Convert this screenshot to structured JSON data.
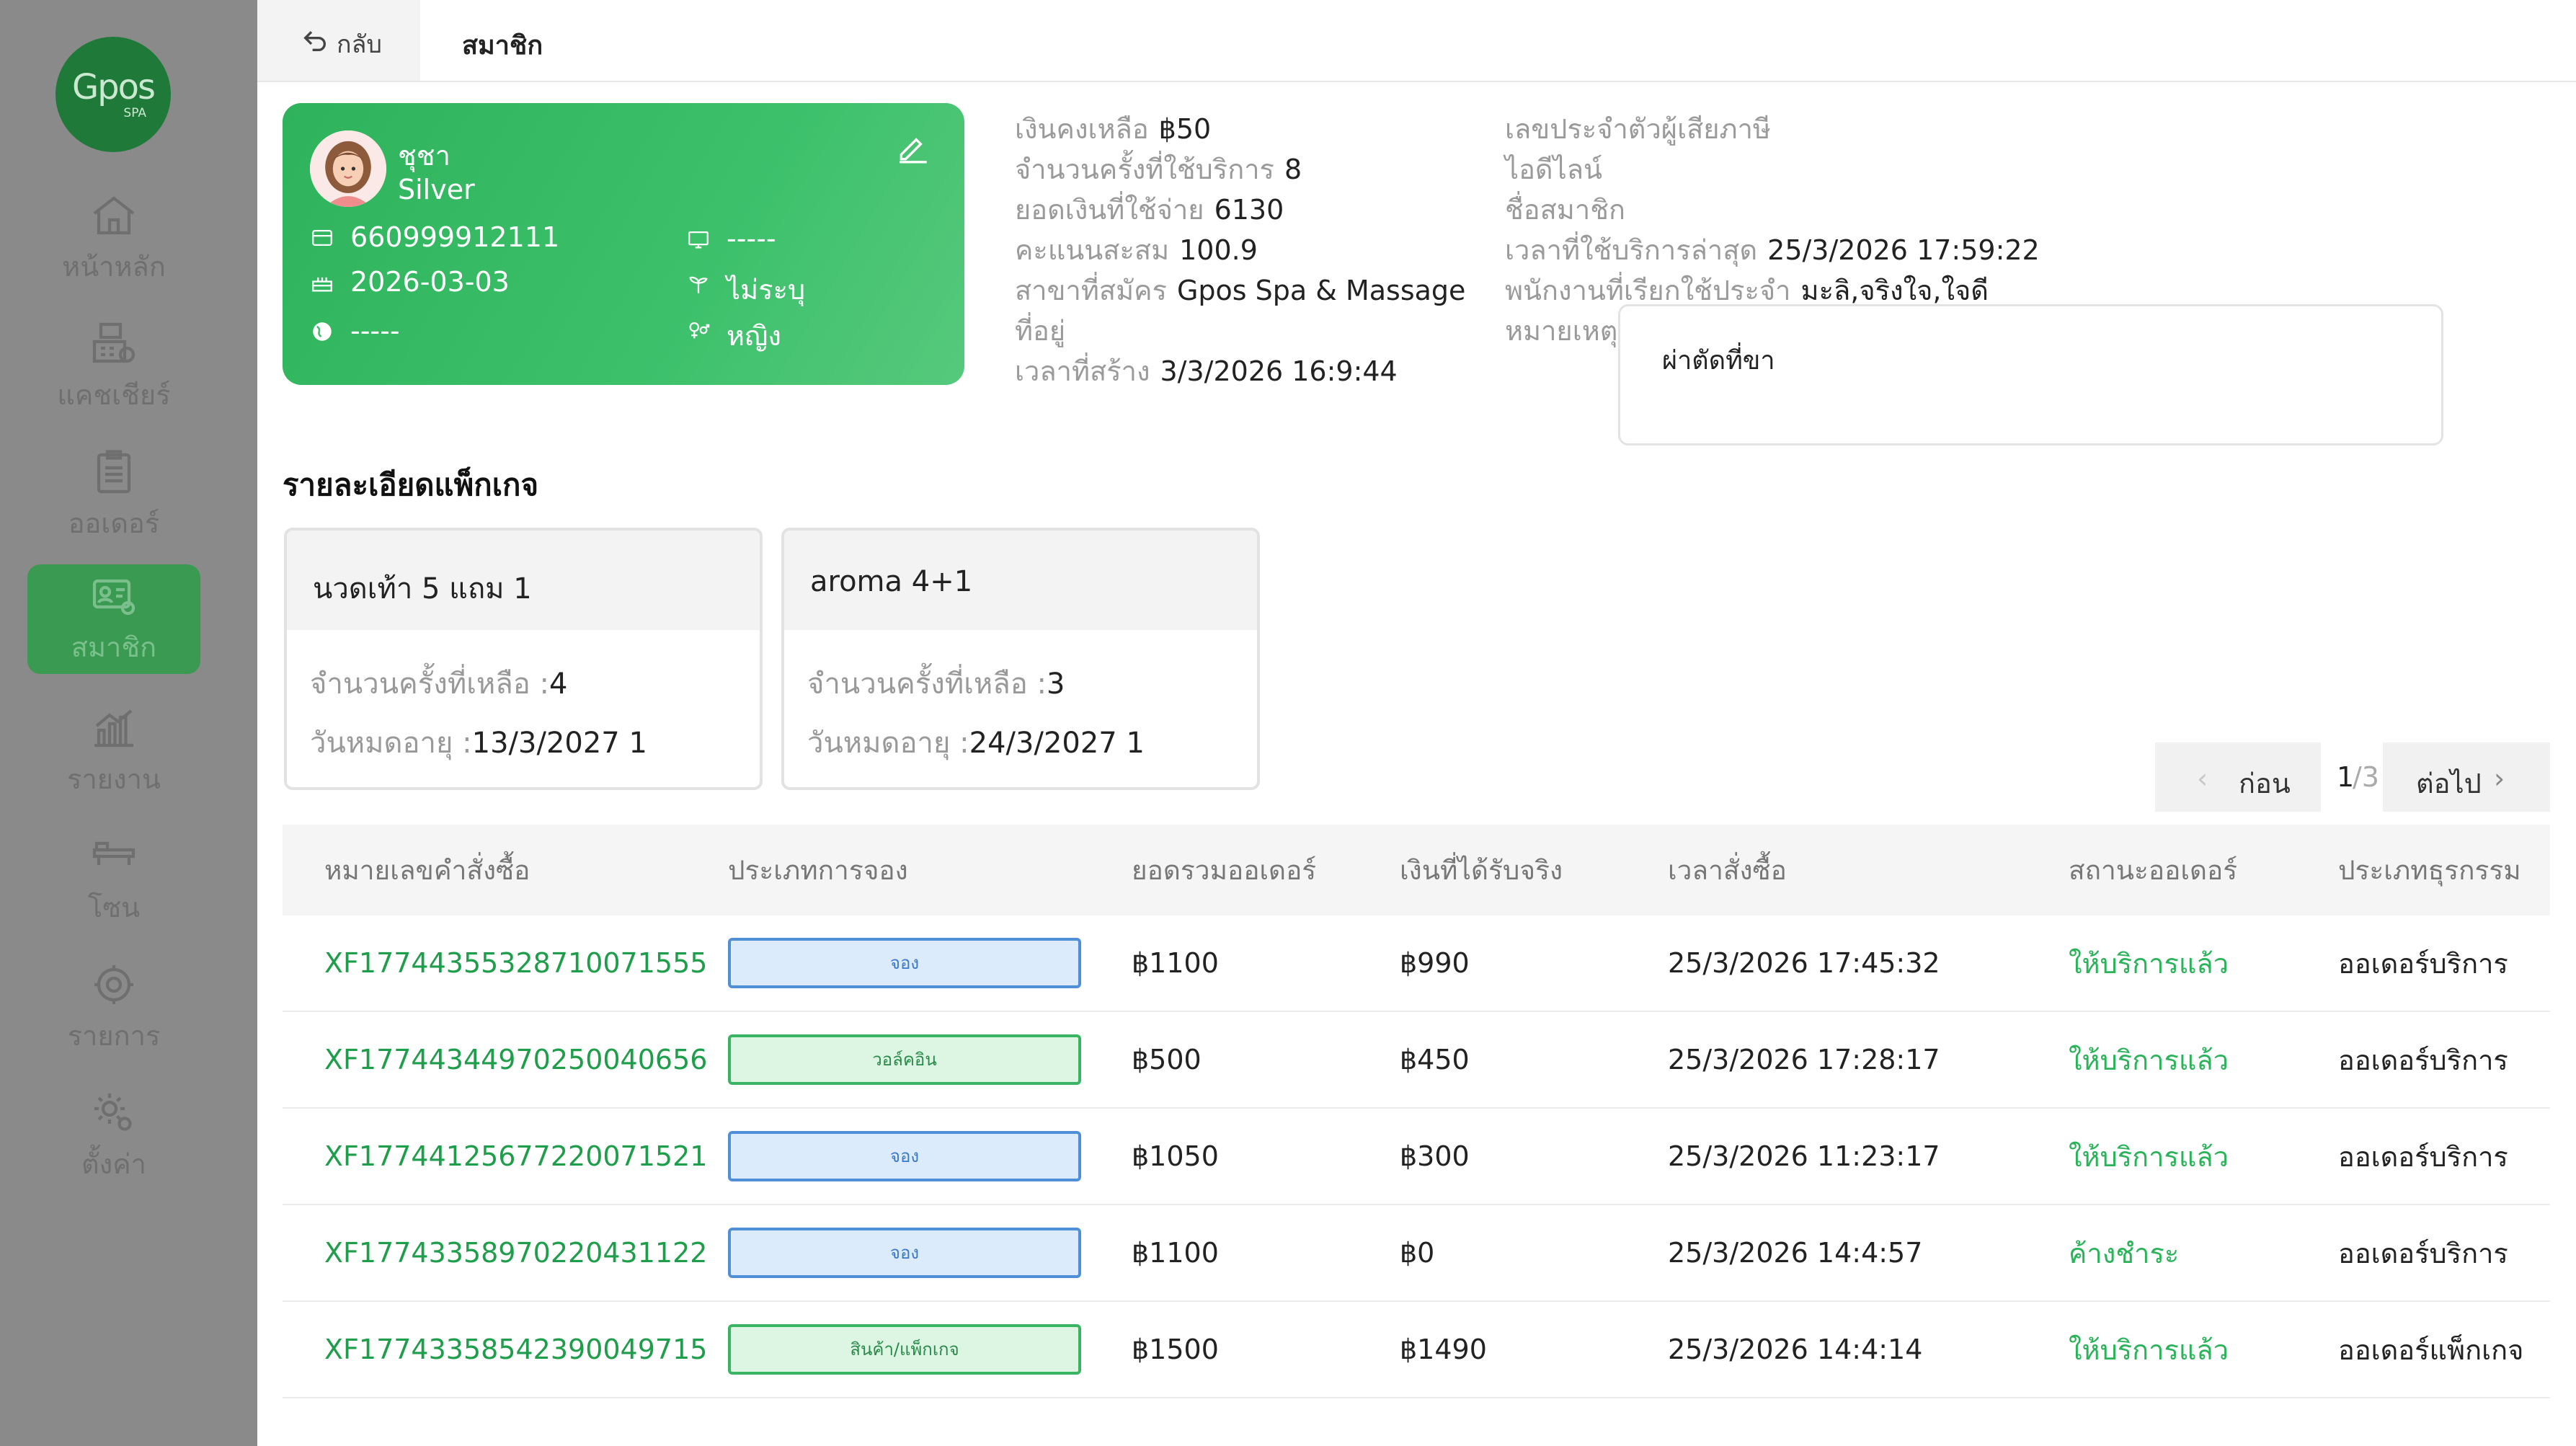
{
  "sidebar": {
    "logo_main": "Gpos",
    "logo_sub": "SPA",
    "items": [
      {
        "label": "หน้าหลัก",
        "icon": "home-icon"
      },
      {
        "label": "แคชเชียร์",
        "icon": "cashier-icon"
      },
      {
        "label": "ออเดอร์",
        "icon": "order-icon"
      },
      {
        "label": "สมาชิก",
        "icon": "member-icon",
        "active": true
      },
      {
        "label": "รายงาน",
        "icon": "report-icon"
      },
      {
        "label": "โซน",
        "icon": "zone-icon"
      },
      {
        "label": "รายการ",
        "icon": "list-icon"
      },
      {
        "label": "ตั้งค่า",
        "icon": "settings-icon"
      }
    ]
  },
  "header": {
    "back_label": "กลับ",
    "title": "สมาชิก"
  },
  "member_card": {
    "name": "ชุชา",
    "level": "Silver",
    "phone": "660999912111",
    "birthday": "2026-03-03",
    "website": "-----",
    "device": "-----",
    "unspecified": "ไม่ระบุ",
    "gender": "หญิง"
  },
  "member_info": {
    "balance_label": "เงินคงเหลือ",
    "balance": "฿50",
    "visits_label": "จำนวนครั้งที่ใช้บริการ",
    "visits": "8",
    "spent_label": "ยอดเงินที่ใช้จ่าย",
    "spent": "6130",
    "points_label": "คะแนนสะสม",
    "points": "100.9",
    "branch_label": "สาขาที่สมัคร",
    "branch": "Gpos Spa & Massage",
    "address_label": "ที่อยู่",
    "created_label": "เวลาที่สร้าง",
    "created": "3/3/2026 16:9:44",
    "tax_id_label": "เลขประจำตัวผู้เสียภาษี",
    "line_id_label": "ไอดีไลน์",
    "member_name_label": "ชื่อสมาชิก",
    "last_visit_label": "เวลาที่ใช้บริการล่าสุด",
    "last_visit": "25/3/2026 17:59:22",
    "staff_label": "พนักงานที่เรียกใช้ประจำ",
    "staff": "มะลิ,จริงใจ,ใจดี",
    "note_label": "หมายเหตุ",
    "note": "ผ่าตัดที่ขา"
  },
  "packages": {
    "title": "รายละเอียดแพ็กเกจ",
    "remaining_label": "จำนวนครั้งที่เหลือ :",
    "expiry_label": "วันหมดอายุ :",
    "items": [
      {
        "name": "นวดเท้า 5 แถม 1",
        "remaining": "4",
        "expiry": "13/3/2027 1"
      },
      {
        "name": "aroma 4+1",
        "remaining": "3",
        "expiry": "24/3/2027 1"
      }
    ]
  },
  "pagination": {
    "prev_label": "ก่อน",
    "current": "1",
    "total": "/3",
    "next_label": "ต่อไป"
  },
  "orders": {
    "columns": [
      "หมายเลขคำสั่งซื้อ",
      "ประเภทการจอง",
      "ยอดรวมออเดอร์",
      "เงินที่ได้รับจริง",
      "เวลาสั่งซื้อ",
      "สถานะออเดอร์",
      "ประเภทธุรกรรม"
    ],
    "rows": [
      {
        "id": "XF17744355328710071555",
        "type": "จอง",
        "type_color": "blue",
        "total": "฿1100",
        "received": "฿990",
        "time": "25/3/2026 17:45:32",
        "status": "ให้บริการแล้ว",
        "txn": "ออเดอร์บริการ"
      },
      {
        "id": "XF17744344970250040656",
        "type": "วอล์คอิน",
        "type_color": "green",
        "total": "฿500",
        "received": "฿450",
        "time": "25/3/2026 17:28:17",
        "status": "ให้บริการแล้ว",
        "txn": "ออเดอร์บริการ"
      },
      {
        "id": "XF17744125677220071521",
        "type": "จอง",
        "type_color": "blue",
        "total": "฿1050",
        "received": "฿300",
        "time": "25/3/2026 11:23:17",
        "status": "ให้บริการแล้ว",
        "txn": "ออเดอร์บริการ"
      },
      {
        "id": "XF17743358970220431122",
        "type": "จอง",
        "type_color": "blue",
        "total": "฿1100",
        "received": "฿0",
        "time": "25/3/2026 14:4:57",
        "status": "ค้างชำระ",
        "txn": "ออเดอร์บริการ"
      },
      {
        "id": "XF17743358542390049715",
        "type": "สินค้า/แพ็กเกจ",
        "type_color": "green",
        "total": "฿1500",
        "received": "฿1490",
        "time": "25/3/2026 14:4:14",
        "status": "ให้บริการแล้ว",
        "txn": "ออเดอร์แพ็กเกจ"
      }
    ]
  },
  "colors": {
    "brand_green": "#2fb25c",
    "sidebar_bg": "#8a8a8a",
    "link_green": "#1e9e4a",
    "tag_blue": "#4f8fd8"
  }
}
